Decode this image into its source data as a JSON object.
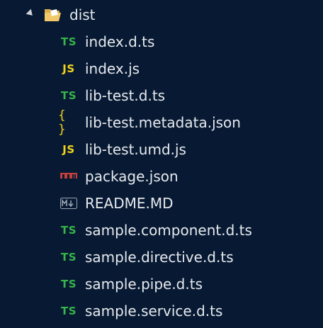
{
  "folder": {
    "label": "dist",
    "expanded": true,
    "icon": "folder-open-icon",
    "icon_color": "#f1c96a"
  },
  "icon_glyphs": {
    "ts": "TS",
    "js": "JS",
    "json": "{ }"
  },
  "colors": {
    "background": "#081a33",
    "text": "#e6e9ee",
    "ts": "#35b54a",
    "js": "#f3d31a",
    "npm": "#c4403d",
    "markdown": "#9aa4b0"
  },
  "files": [
    {
      "label": "index.d.ts",
      "icon": "typescript-icon"
    },
    {
      "label": "index.js",
      "icon": "javascript-icon"
    },
    {
      "label": "lib-test.d.ts",
      "icon": "typescript-icon"
    },
    {
      "label": "lib-test.metadata.json",
      "icon": "json-icon"
    },
    {
      "label": "lib-test.umd.js",
      "icon": "javascript-icon"
    },
    {
      "label": "package.json",
      "icon": "npm-icon"
    },
    {
      "label": "README.MD",
      "icon": "markdown-icon"
    },
    {
      "label": "sample.component.d.ts",
      "icon": "typescript-icon"
    },
    {
      "label": "sample.directive.d.ts",
      "icon": "typescript-icon"
    },
    {
      "label": "sample.pipe.d.ts",
      "icon": "typescript-icon"
    },
    {
      "label": "sample.service.d.ts",
      "icon": "typescript-icon"
    }
  ]
}
